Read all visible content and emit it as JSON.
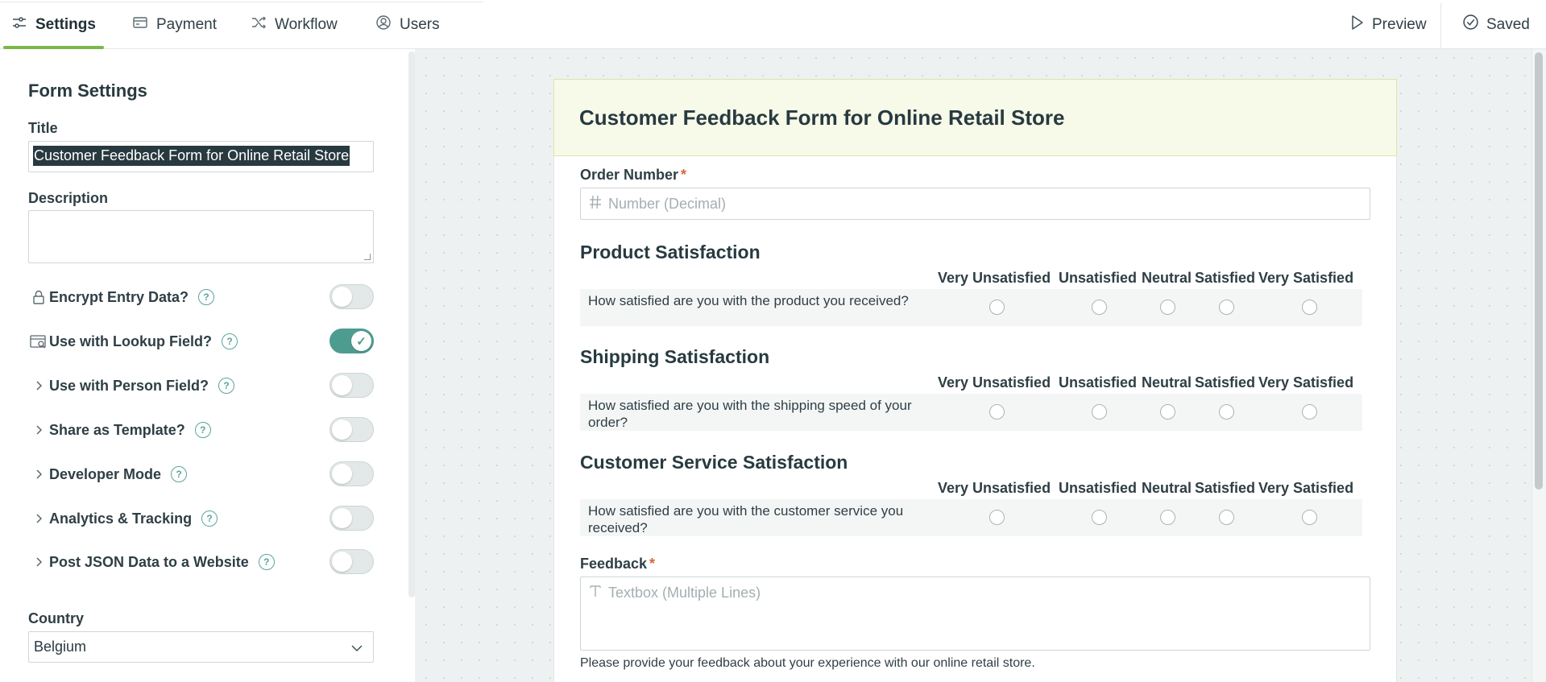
{
  "tabs": [
    {
      "label": "Settings",
      "icon": "sliders-icon",
      "active": true
    },
    {
      "label": "Payment",
      "icon": "credit-card-icon",
      "active": false
    },
    {
      "label": "Workflow",
      "icon": "shuffle-icon",
      "active": false
    },
    {
      "label": "Users",
      "icon": "user-circle-icon",
      "active": false
    }
  ],
  "actions": {
    "preview_label": "Preview",
    "saved_label": "Saved"
  },
  "settings": {
    "heading": "Form Settings",
    "title_label": "Title",
    "title_value": "Customer Feedback Form for Online Retail Store",
    "description_label": "Description",
    "description_value": "",
    "options": [
      {
        "label": "Encrypt Entry Data?",
        "lead_icon": "lock-icon",
        "enabled": false
      },
      {
        "label": "Use with Lookup Field?",
        "lead_icon": "lookup-icon",
        "enabled": true
      },
      {
        "label": "Use with Person Field?",
        "lead_icon": "chevron-right-icon",
        "enabled": false
      },
      {
        "label": "Share as Template?",
        "lead_icon": "chevron-right-icon",
        "enabled": false
      },
      {
        "label": "Developer Mode",
        "lead_icon": "chevron-right-icon",
        "enabled": false
      },
      {
        "label": "Analytics & Tracking",
        "lead_icon": "chevron-right-icon",
        "enabled": false
      },
      {
        "label": "Post JSON Data to a Website",
        "lead_icon": "chevron-right-icon",
        "enabled": false
      }
    ],
    "country_label": "Country",
    "country_value": "Belgium"
  },
  "form": {
    "title": "Customer Feedback Form for Online Retail Store",
    "order_number": {
      "label": "Order Number",
      "required_mark": "*",
      "placeholder": "Number (Decimal)"
    },
    "scale": [
      "Very Unsatisfied",
      "Unsatisfied",
      "Neutral",
      "Satisfied",
      "Very Satisfied"
    ],
    "sections": [
      {
        "title": "Product Satisfaction",
        "question": "How satisfied are you with the product you received?"
      },
      {
        "title": "Shipping Satisfaction",
        "question": "How satisfied are you with the shipping speed of your order?"
      },
      {
        "title": "Customer Service Satisfaction",
        "question": "How satisfied are you with the customer service you received?"
      }
    ],
    "feedback": {
      "label": "Feedback",
      "required_mark": "*",
      "placeholder": "Textbox (Multiple Lines)",
      "help": "Please provide your feedback about your experience with our online retail store."
    }
  },
  "colors": {
    "accent_green": "#7ab848",
    "toggle_on": "#4e9c8f",
    "required": "#d9643a",
    "header_bg": "#f7fae9"
  }
}
